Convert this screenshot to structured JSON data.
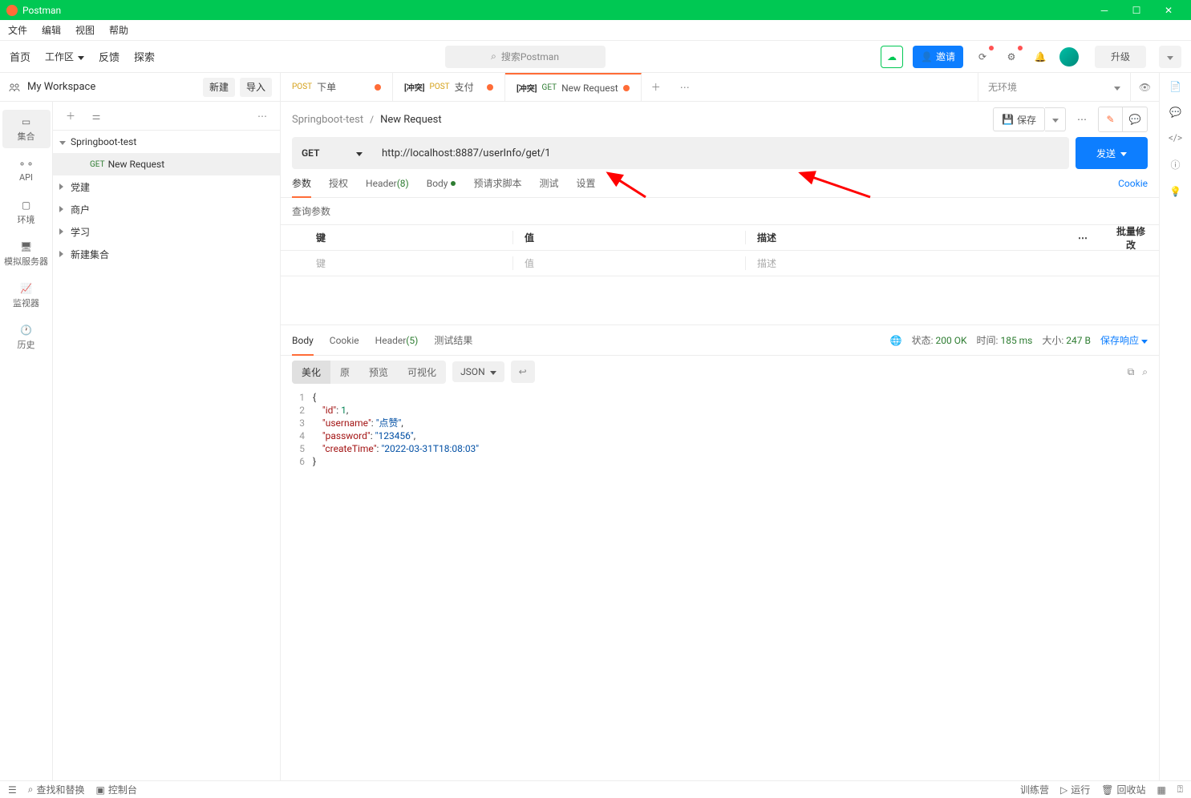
{
  "window": {
    "title": "Postman"
  },
  "menubar": [
    "文件",
    "编辑",
    "视图",
    "帮助"
  ],
  "toolbar": {
    "home": "首页",
    "workspace": "工作区",
    "feedback": "反馈",
    "explore": "探索",
    "search_placeholder": "搜索Postman",
    "invite": "邀请",
    "upgrade": "升级"
  },
  "workspace": {
    "name": "My Workspace",
    "new_btn": "新建",
    "import_btn": "导入"
  },
  "rail": {
    "collections": "集合",
    "api": "API",
    "env": "环境",
    "mock": "模拟服务器",
    "monitor": "监视器",
    "history": "历史"
  },
  "tree": {
    "root": "Springboot-test",
    "request_method": "GET",
    "request_name": "New Request",
    "folders": [
      "党建",
      "商户",
      "学习",
      "新建集合"
    ]
  },
  "tabs": [
    {
      "method": "POST",
      "method_class": "post",
      "label": "下单",
      "conflict": "",
      "unsaved": true
    },
    {
      "method": "POST",
      "method_class": "post",
      "label": "支付",
      "conflict": "[冲突]",
      "unsaved": true
    },
    {
      "method": "GET",
      "method_class": "get",
      "label": "New Request",
      "conflict": "[冲突]",
      "unsaved": true,
      "active": true
    }
  ],
  "env": {
    "none": "无环境"
  },
  "breadcrumb": {
    "parent": "Springboot-test",
    "current": "New Request",
    "save": "保存"
  },
  "request": {
    "method": "GET",
    "url": "http://localhost:8887/userInfo/get/1",
    "send": "发送"
  },
  "req_tabs": {
    "params": "参数",
    "auth": "授权",
    "headers": "Header",
    "headers_count": "(8)",
    "body": "Body",
    "prerequest": "预请求脚本",
    "tests": "测试",
    "settings": "设置",
    "cookies": "Cookie"
  },
  "params_section": {
    "title": "查询参数",
    "key_h": "键",
    "val_h": "值",
    "desc_h": "描述",
    "bulk": "批量修改",
    "key_ph": "键",
    "val_ph": "值",
    "desc_ph": "描述"
  },
  "resp_tabs": {
    "body": "Body",
    "cookie": "Cookie",
    "header": "Header",
    "header_count": "(5)",
    "tests": "测试结果"
  },
  "resp_meta": {
    "status_lbl": "状态:",
    "status_val": "200 OK",
    "time_lbl": "时间:",
    "time_val": "185 ms",
    "size_lbl": "大小:",
    "size_val": "247 B",
    "save_resp": "保存响应"
  },
  "view_tabs": {
    "pretty": "美化",
    "raw": "原",
    "preview": "预览",
    "visualize": "可视化",
    "format": "JSON"
  },
  "json_response": {
    "id": 1,
    "username": "点赞",
    "password": "123456",
    "createTime": "2022-03-31T18:08:03"
  },
  "statusbar": {
    "find": "查找和替换",
    "console": "控制台",
    "bootcamp": "训练营",
    "runner": "运行",
    "trash": "回收站"
  }
}
